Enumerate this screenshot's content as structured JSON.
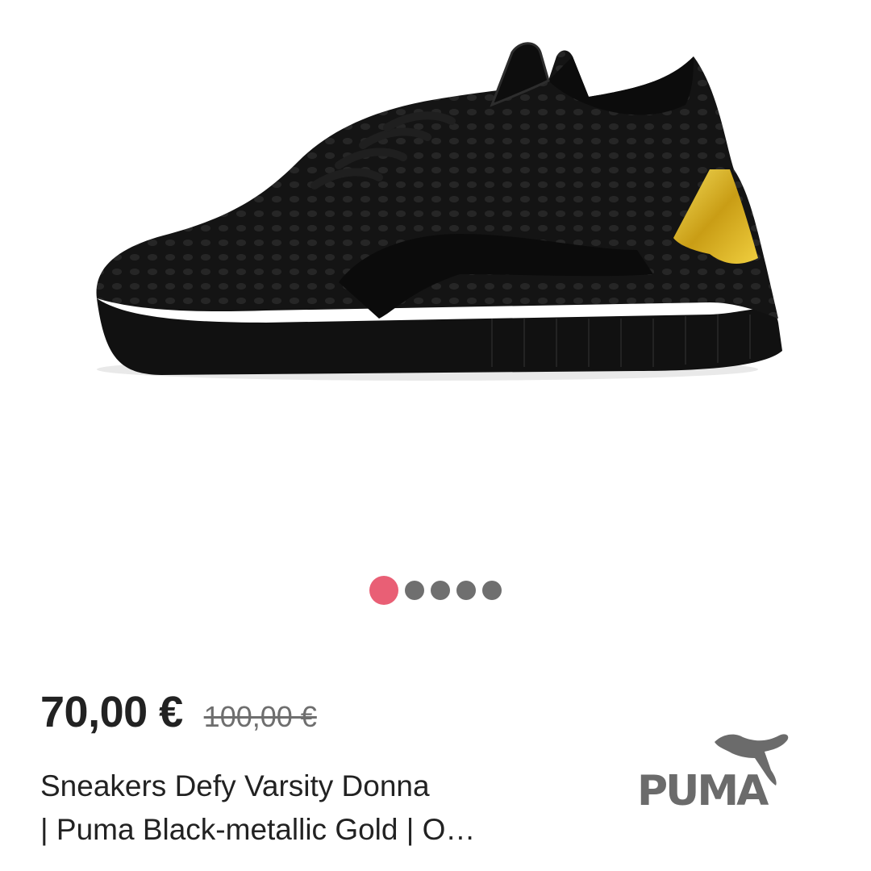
{
  "carousel": {
    "slide_count": 5,
    "active_index": 0,
    "active_color": "#e95f75",
    "inactive_color": "#6f6f6f"
  },
  "product": {
    "price": "70,00 €",
    "original_price": "100,00 €",
    "title_line1": "Sneakers Defy Varsity Donna",
    "title_line2": "| Puma Black-metallic Gold | O…",
    "brand": "PUMA",
    "image_icon": "sneaker-image"
  },
  "colors": {
    "price": "#222222",
    "strike_price": "#6e6e6e",
    "brand_logo": "#6b6b6b",
    "shoe": "#141414",
    "shoe_accent": "#d8b325"
  }
}
